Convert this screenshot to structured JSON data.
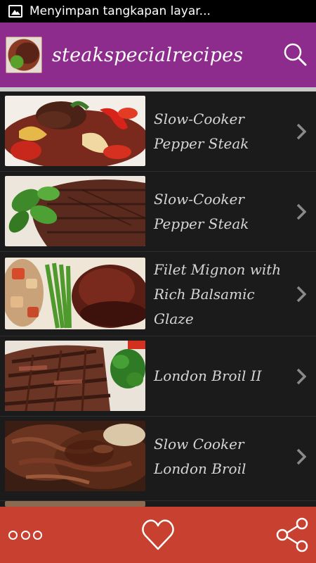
{
  "status_bar": {
    "text": "Menyimpan tangkapan layar..."
  },
  "app_bar": {
    "title": "steakspecialrecipes"
  },
  "recipes": [
    {
      "title_lines": [
        "Slow-Cooker",
        "Pepper Steak"
      ]
    },
    {
      "title_lines": [
        "Slow-Cooker",
        "Pepper Steak"
      ]
    },
    {
      "title_lines": [
        "Filet Mignon with",
        "Rich Balsamic",
        "Glaze"
      ]
    },
    {
      "title_lines": [
        "London Broil II"
      ]
    },
    {
      "title_lines": [
        "Slow Cooker",
        "London Broil"
      ]
    }
  ],
  "colors": {
    "app_bar": "#8e2c8e",
    "bottom_bar": "#c8402f",
    "list_bg": "#1b1b1b"
  },
  "icons": {
    "search": "search-icon",
    "chevron": "chevron-right-icon",
    "more": "more-dots-icon",
    "favorite": "heart-icon",
    "share": "share-icon",
    "status": "image-icon"
  }
}
